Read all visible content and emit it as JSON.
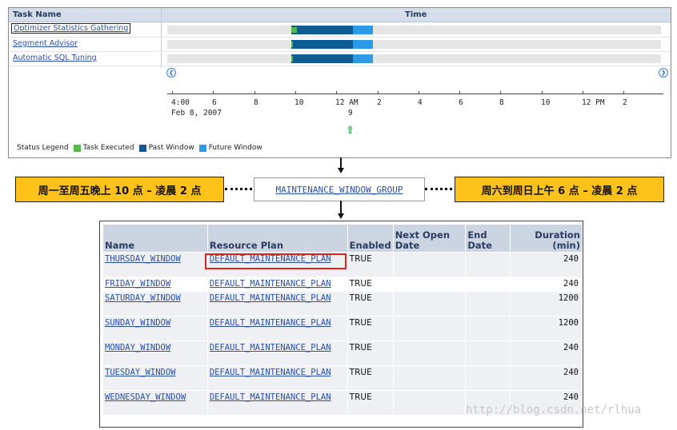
{
  "timeline": {
    "headers": {
      "task_name": "Task Name",
      "time": "Time"
    },
    "tasks": [
      {
        "name": "Optimizer Statistics Gathering",
        "focused": true,
        "exec": 0.04
      },
      {
        "name": "Segment Advisor",
        "focused": false,
        "exec": 0.01
      },
      {
        "name": "Automatic SQL Tuning",
        "focused": false,
        "exec": 0.01
      }
    ],
    "ticks": [
      {
        "label": "4:00",
        "sub": "Feb 8, 2007"
      },
      {
        "label": "6",
        "sub": ""
      },
      {
        "label": "8",
        "sub": ""
      },
      {
        "label": "10",
        "sub": ""
      },
      {
        "label": "12 AM",
        "sub": "9"
      },
      {
        "label": "2",
        "sub": ""
      },
      {
        "label": "4",
        "sub": ""
      },
      {
        "label": "6",
        "sub": ""
      },
      {
        "label": "8",
        "sub": ""
      },
      {
        "label": "10",
        "sub": ""
      },
      {
        "label": "12 PM",
        "sub": ""
      },
      {
        "label": "2",
        "sub": ""
      }
    ],
    "legend": {
      "title": "Status Legend",
      "items": [
        {
          "label": "Task Executed",
          "color": "#56b84d"
        },
        {
          "label": "Past Window",
          "color": "#0f5b92"
        },
        {
          "label": "Future Window",
          "color": "#2b9be8"
        }
      ]
    },
    "colors": {
      "past": "#0f5b92",
      "future": "#2b9be8",
      "executed": "#56b84d"
    }
  },
  "group": {
    "name": "MAINTENANCE_WINDOW_GROUP",
    "left_label": "周一至周五晚上 10 点 – 凌晨 2 点",
    "right_label": "周六到周日上午 6 点 – 凌晨 2 点"
  },
  "windows_table": {
    "columns": {
      "name": "Name",
      "plan": "Resource Plan",
      "enabled": "Enabled",
      "next_open": "Next Open Date",
      "end_date": "End Date",
      "duration": "Duration (min)"
    },
    "rows": [
      {
        "name": "THURSDAY_WINDOW",
        "plan": "DEFAULT_MAINTENANCE_PLAN",
        "enabled": "TRUE",
        "duration": "240",
        "highlight": true
      },
      {
        "name": "FRIDAY_WINDOW",
        "plan": "DEFAULT_MAINTENANCE_PLAN",
        "enabled": "TRUE",
        "duration": "240",
        "highlight": false
      },
      {
        "name": "SATURDAY_WINDOW",
        "plan": "DEFAULT_MAINTENANCE_PLAN",
        "enabled": "TRUE",
        "duration": "1200",
        "highlight": false
      },
      {
        "name": "SUNDAY_WINDOW",
        "plan": "DEFAULT_MAINTENANCE_PLAN",
        "enabled": "TRUE",
        "duration": "1200",
        "highlight": false
      },
      {
        "name": "MONDAY_WINDOW",
        "plan": "DEFAULT_MAINTENANCE_PLAN",
        "enabled": "TRUE",
        "duration": "240",
        "highlight": false
      },
      {
        "name": "TUESDAY_WINDOW",
        "plan": "DEFAULT_MAINTENANCE_PLAN",
        "enabled": "TRUE",
        "duration": "240",
        "highlight": false
      },
      {
        "name": "WEDNESDAY_WINDOW",
        "plan": "DEFAULT_MAINTENANCE_PLAN",
        "enabled": "TRUE",
        "duration": "240",
        "highlight": false
      }
    ]
  },
  "watermark": "http://blog.csdn.net/rlhua"
}
